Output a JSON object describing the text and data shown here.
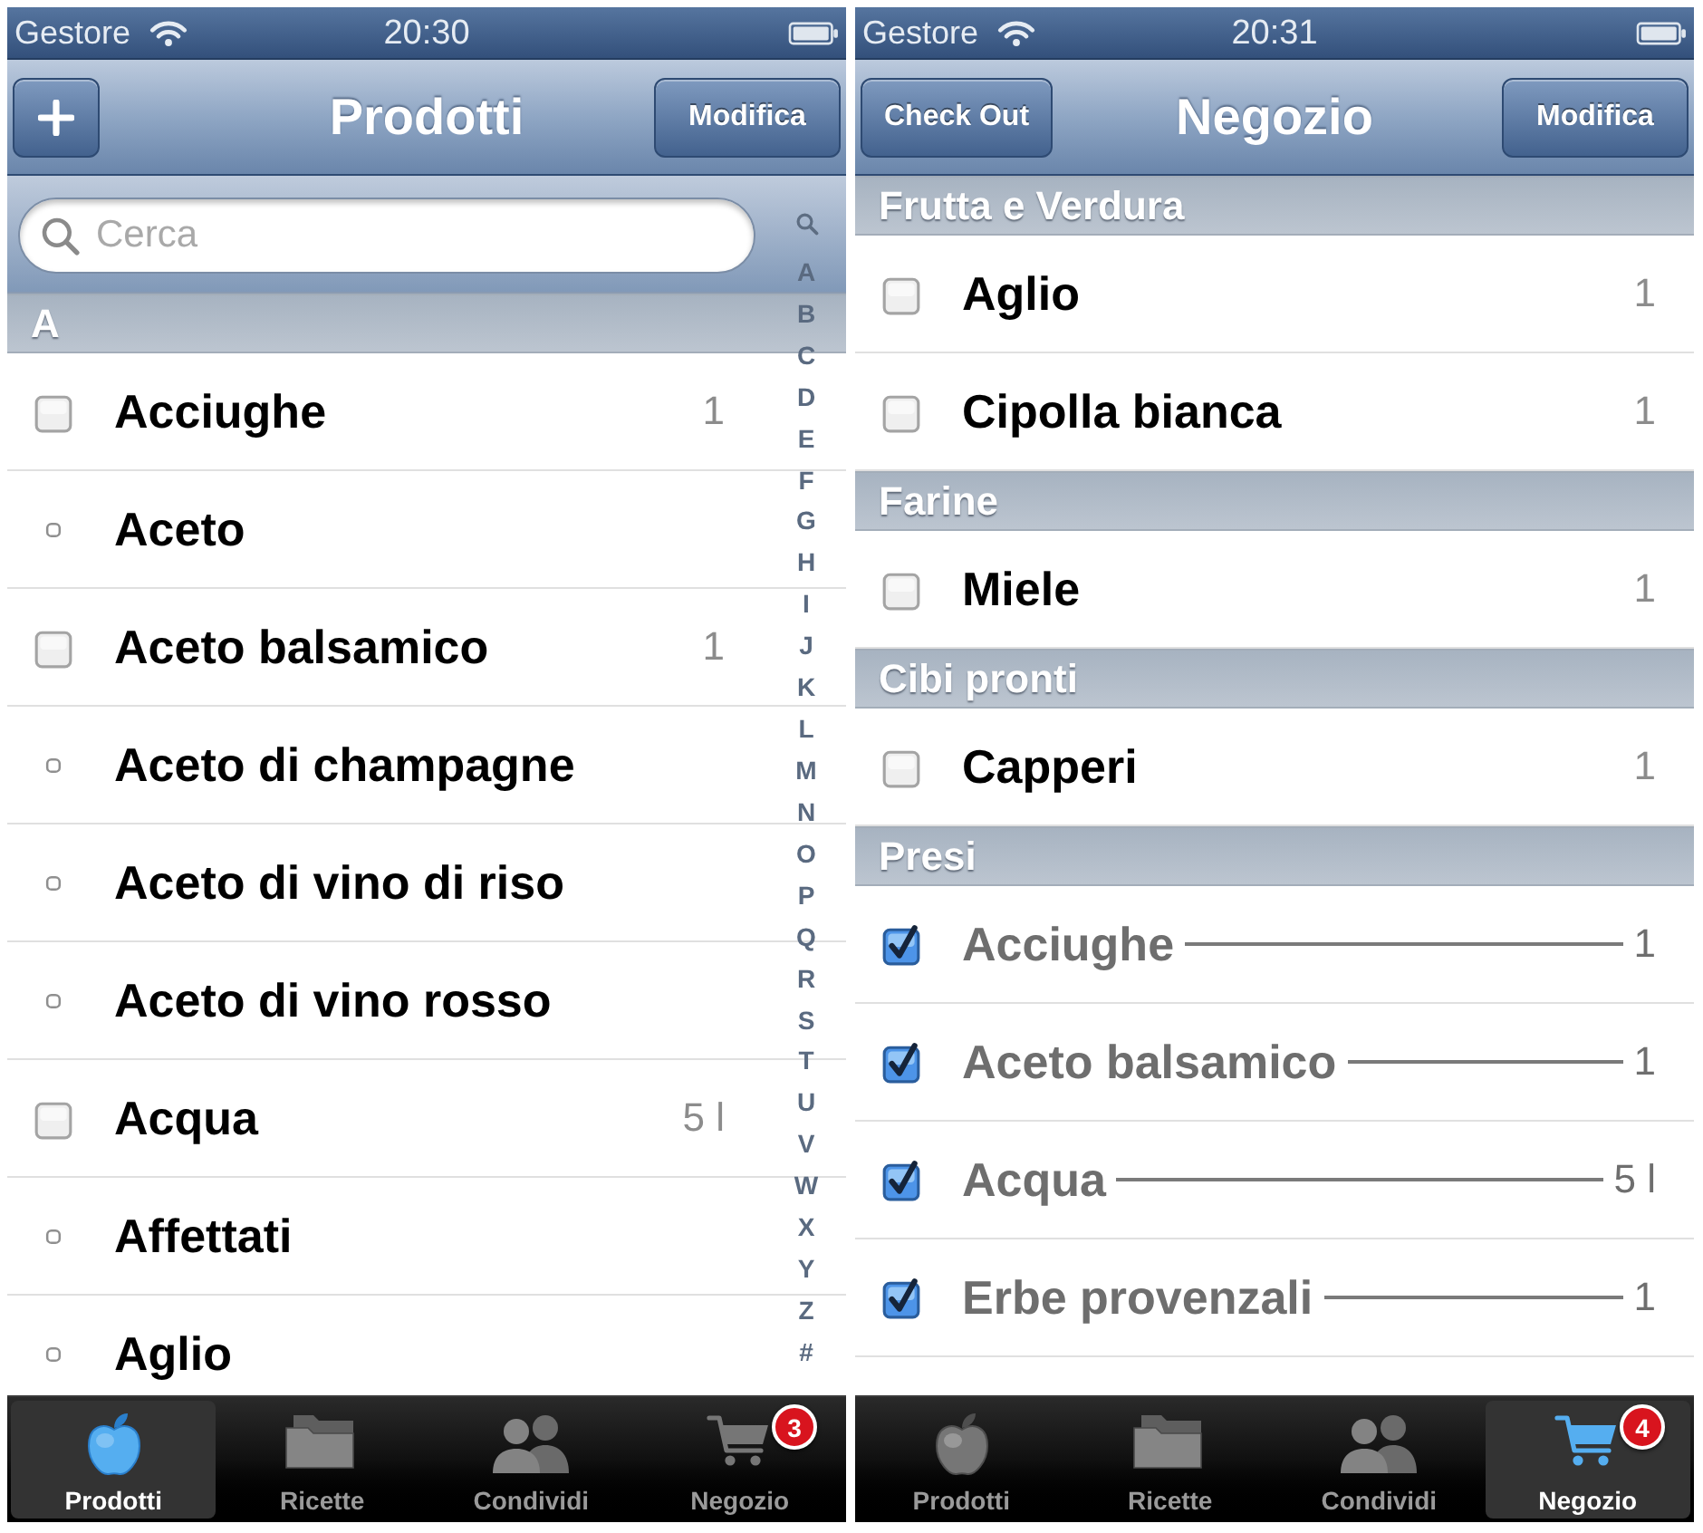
{
  "screens": [
    {
      "status_bar": {
        "carrier": "Gestore",
        "time": "20:30"
      },
      "nav_bar": {
        "left_button": {
          "kind": "add"
        },
        "title": "Prodotti",
        "right_button": {
          "kind": "text",
          "label": "Modifica"
        }
      },
      "search": {
        "placeholder": "Cerca"
      },
      "index": [
        "A",
        "B",
        "C",
        "D",
        "E",
        "F",
        "G",
        "H",
        "I",
        "J",
        "K",
        "L",
        "M",
        "N",
        "O",
        "P",
        "Q",
        "R",
        "S",
        "T",
        "U",
        "V",
        "W",
        "X",
        "Y",
        "Z",
        "#"
      ],
      "sections": [
        {
          "title": "A",
          "items": [
            {
              "kind": "checkbox",
              "name": "Acciughe",
              "checked": false,
              "quantity": "1"
            },
            {
              "kind": "bullet",
              "name": "Aceto"
            },
            {
              "kind": "checkbox",
              "name": "Aceto balsamico",
              "checked": false,
              "quantity": "1"
            },
            {
              "kind": "bullet",
              "name": "Aceto di champagne"
            },
            {
              "kind": "bullet",
              "name": "Aceto di vino di riso"
            },
            {
              "kind": "bullet",
              "name": "Aceto di vino rosso"
            },
            {
              "kind": "checkbox",
              "name": "Acqua",
              "checked": false,
              "quantity": "5 l"
            },
            {
              "kind": "bullet",
              "name": "Affettati"
            },
            {
              "kind": "bullet",
              "name": "Aglio"
            }
          ]
        }
      ],
      "tabs": [
        {
          "label": "Prodotti",
          "selected": true
        },
        {
          "label": "Ricette",
          "selected": false
        },
        {
          "label": "Condividi",
          "selected": false
        },
        {
          "label": "Negozio",
          "selected": false,
          "badge": "3"
        }
      ]
    },
    {
      "status_bar": {
        "carrier": "Gestore",
        "time": "20:31"
      },
      "nav_bar": {
        "left_button": {
          "kind": "text",
          "label": "Check Out"
        },
        "title": "Negozio",
        "right_button": {
          "kind": "text",
          "label": "Modifica"
        }
      },
      "sections": [
        {
          "title": "Frutta e Verdura",
          "items": [
            {
              "kind": "checkbox",
              "name": "Aglio",
              "checked": false,
              "quantity": "1"
            },
            {
              "kind": "checkbox",
              "name": "Cipolla bianca",
              "checked": false,
              "quantity": "1"
            }
          ]
        },
        {
          "title": "Farine",
          "items": [
            {
              "kind": "checkbox",
              "name": "Miele",
              "checked": false,
              "quantity": "1"
            }
          ]
        },
        {
          "title": "Cibi pronti",
          "items": [
            {
              "kind": "checkbox",
              "name": "Capperi",
              "checked": false,
              "quantity": "1"
            }
          ]
        },
        {
          "title": "Presi",
          "items": [
            {
              "kind": "checkbox",
              "name": "Acciughe",
              "checked": true,
              "quantity": "1"
            },
            {
              "kind": "checkbox",
              "name": "Aceto balsamico",
              "checked": true,
              "quantity": "1"
            },
            {
              "kind": "checkbox",
              "name": "Acqua",
              "checked": true,
              "quantity": "5 l"
            },
            {
              "kind": "checkbox",
              "name": "Erbe provenzali",
              "checked": true,
              "quantity": "1"
            }
          ]
        }
      ],
      "tabs": [
        {
          "label": "Prodotti",
          "selected": false
        },
        {
          "label": "Ricette",
          "selected": false
        },
        {
          "label": "Condividi",
          "selected": false
        },
        {
          "label": "Negozio",
          "selected": true,
          "badge": "4"
        }
      ]
    }
  ]
}
